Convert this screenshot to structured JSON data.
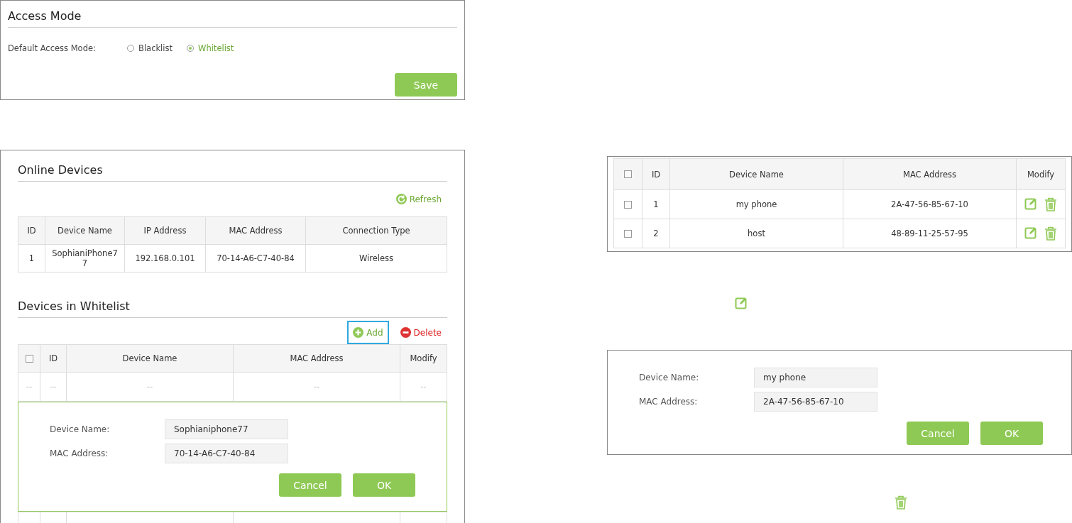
{
  "access_mode": {
    "title": "Access Mode",
    "label": "Default Access Mode:",
    "options": [
      {
        "label": "Blacklist",
        "selected": false
      },
      {
        "label": "Whitelist",
        "selected": true
      }
    ],
    "save_button": "Save"
  },
  "online_devices": {
    "title": "Online Devices",
    "refresh": "Refresh",
    "columns": [
      "ID",
      "Device Name",
      "IP Address",
      "MAC Address",
      "Connection Type"
    ],
    "rows": [
      {
        "id": "1",
        "device_name": "SophianiPhone77",
        "ip": "192.168.0.101",
        "mac": "70-14-A6-C7-40-84",
        "connection": "Wireless"
      }
    ]
  },
  "whitelist": {
    "title": "Devices in Whitelist",
    "add": {
      "label": "Add",
      "highlighted": true
    },
    "delete": "Delete",
    "header_checked": false,
    "columns": [
      "ID",
      "Device Name",
      "MAC Address",
      "Modify"
    ],
    "empty_row": [
      "--",
      "--",
      "--",
      "--",
      "--"
    ],
    "form": {
      "fields": [
        {
          "label": "Device Name:",
          "value": "Sophianiphone77"
        },
        {
          "label": "MAC Address:",
          "value": "70-14-A6-C7-40-84"
        }
      ],
      "buttons": [
        "Cancel",
        "OK"
      ]
    }
  },
  "device_table": {
    "header_checked": false,
    "columns": [
      "ID",
      "Device Name",
      "MAC Address",
      "Modify"
    ],
    "rows": [
      {
        "checked": false,
        "id": "1",
        "device_name": "my phone",
        "mac": "2A-47-56-85-67-10"
      },
      {
        "checked": false,
        "id": "2",
        "device_name": "host",
        "mac": "48-89-11-25-57-95"
      }
    ]
  },
  "edit_dialog": {
    "fields": [
      {
        "label": "Device Name:",
        "value": "my phone"
      },
      {
        "label": "MAC Address:",
        "value": "2A-47-56-85-67-10"
      }
    ],
    "buttons": [
      "Cancel",
      "OK"
    ]
  }
}
